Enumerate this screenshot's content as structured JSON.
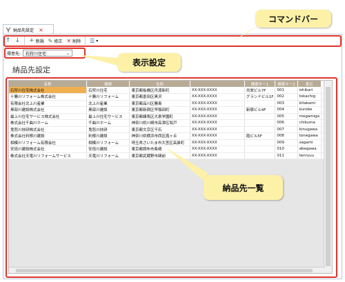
{
  "tab": {
    "label": "納品先設定",
    "close": "×"
  },
  "toolbar": {
    "up": "↑",
    "down": "↓",
    "new": "新規",
    "edit": "修正",
    "delete": "削除",
    "view_menu": "▾"
  },
  "display": {
    "label": "得意先:",
    "value": "石狩川住宅",
    "chevron": "⌄"
  },
  "page_title": "納品先設定",
  "callouts": {
    "command_bar": "コマンドバー",
    "display_settings": "表示設定",
    "delivery_list": "納品先一覧"
  },
  "colors": {
    "header": "#b8ab96",
    "selected": "#f0b050",
    "callout": "#fdf1a8",
    "highlight": "#e0322c"
  },
  "table": {
    "headers": [
      "名称",
      "略称",
      "住所",
      "",
      "検索キー1",
      "検索キー2",
      "表示"
    ],
    "rows": [
      [
        "石狩川住宅株式会社",
        "石狩川住宅",
        "東京都板橋区舟渡新町",
        "XX-XXX-XXXX",
        "共栄ビル7F",
        "001",
        "ishikari"
      ],
      [
        "十勝川リフォーム株式会社",
        "十勝川リフォーム",
        "東京都墨田区黒沢",
        "XX-XXX-XXXX",
        "グランドビル1F",
        "002",
        "tokachig"
      ],
      [
        "有限会社北上川産業",
        "北上川産業",
        "東京都品川区勝島",
        "XX-XXX-XXXX",
        "",
        "003",
        "kitakami"
      ],
      [
        "黒部川建設株式会社",
        "黒部川建設",
        "東京都新宿区早稲田町",
        "XX-XXX-XXXX",
        "新宿ビル4F",
        "004",
        "kurobe"
      ],
      [
        "最上川住宅サービス株式会社",
        "最上川住宅サービス",
        "東京都練馬区大泉学園町",
        "XX-XXX-XXXX",
        "",
        "005",
        "mogamiga"
      ],
      [
        "株式会社千曲川ホーム",
        "千曲川ホーム",
        "神奈川県川崎市高津区坂戸",
        "XX-XXX-XXXX",
        "",
        "006",
        "chikuma"
      ],
      [
        "鬼怒川技研株式会社",
        "鬼怒川技研",
        "東京都文京区千石",
        "XX-XXX-XXXX",
        "",
        "007",
        "kinugawa"
      ],
      [
        "株式会社利根川建設",
        "利根川建設",
        "神奈川県横浜市西区霞ヶ丘",
        "XX-XXX-XXXX",
        "霞ビル5F",
        "008",
        "tonegawa"
      ],
      [
        "相模川リフォーム有限会社",
        "相模川リフォーム",
        "埼玉県さいたま市大宮区高鼻町",
        "XX-XXX-XXXX",
        "",
        "009",
        "sagami"
      ],
      [
        "安倍川建設株式会社",
        "安倍川建設",
        "東京都調布市柴崎",
        "XX-XXX-XXXX",
        "",
        "010",
        "abegawa"
      ],
      [
        "株式会社天竜川リフォームサービス",
        "天竜川リフォーム",
        "東京都武蔵野市関前",
        "XX-XXX-XXXX",
        "",
        "011",
        "tenryuu"
      ]
    ]
  }
}
